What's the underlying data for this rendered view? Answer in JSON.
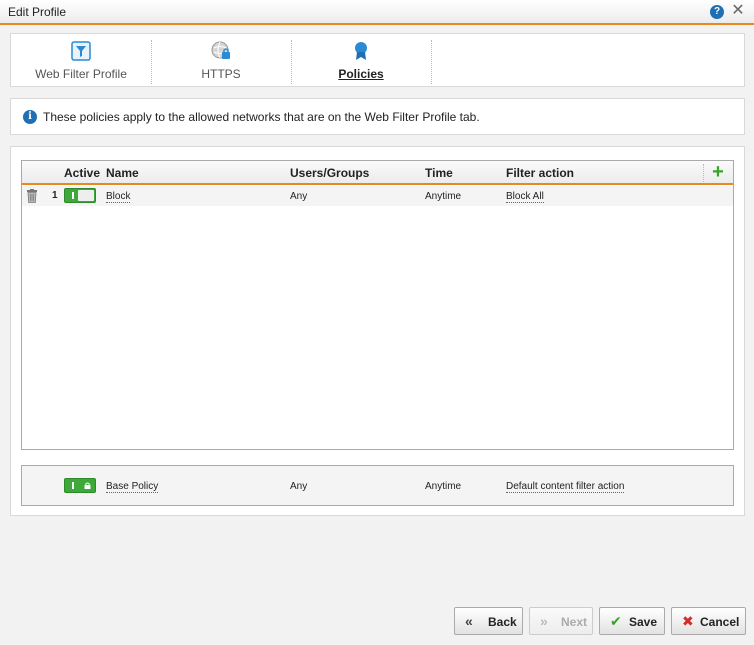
{
  "window": {
    "title": "Edit Profile"
  },
  "tabs": [
    {
      "label": "Web Filter Profile",
      "active": false,
      "icon": "filter-icon"
    },
    {
      "label": "HTTPS",
      "active": false,
      "icon": "globe-lock-icon"
    },
    {
      "label": "Policies",
      "active": true,
      "icon": "ribbon-icon"
    }
  ],
  "info": {
    "text": "These policies apply to the allowed networks that are on the Web Filter Profile tab."
  },
  "grid": {
    "columns": [
      "Active",
      "Name",
      "Users/Groups",
      "Time",
      "Filter action"
    ],
    "rows": [
      {
        "num": "1",
        "name": "Block",
        "users": "Any",
        "time": "Anytime",
        "action": "Block All",
        "active": true
      }
    ]
  },
  "base_policy": {
    "name": "Base Policy",
    "users": "Any",
    "time": "Anytime",
    "action": "Default content filter action",
    "active": true
  },
  "buttons": {
    "back": "Back",
    "next": "Next",
    "save": "Save",
    "cancel": "Cancel"
  },
  "colors": {
    "accent": "#e8891a",
    "toggle_on": "#3ea83a",
    "info_blue": "#1f6fb5",
    "cancel_red": "#d62b2b",
    "save_green": "#3aa32a"
  }
}
